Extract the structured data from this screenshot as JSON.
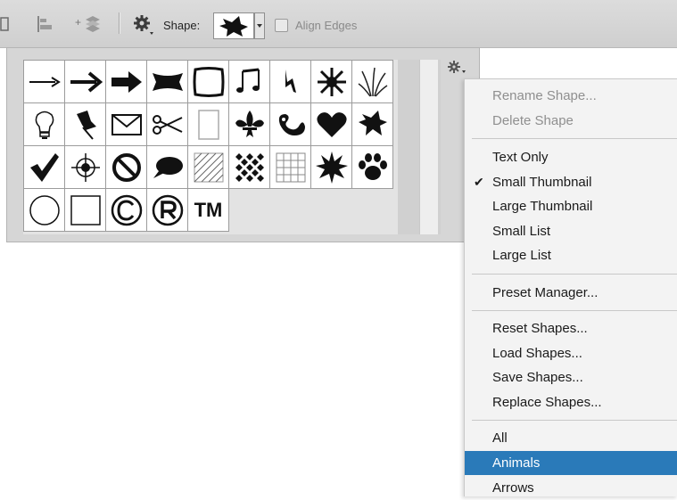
{
  "toolbar": {
    "shape_label": "Shape:",
    "align_edges_label": "Align Edges",
    "icons": [
      "path-operations-icon",
      "path-alignment-icon",
      "path-arrangement-icon",
      "gear-icon",
      "shape-picker-icon",
      "checkbox-icon"
    ]
  },
  "picker": {
    "shapes": [
      "thin-arrow",
      "bold-arrow",
      "heavy-arrow",
      "banner",
      "frame-square",
      "music-note",
      "lightning-bolt",
      "starburst",
      "grass",
      "light-bulb",
      "pushpin",
      "envelope",
      "scissors",
      "blank-page",
      "fleur-de-lis",
      "ornament",
      "heart",
      "puzzle-splat",
      "checkmark",
      "target-crosshair",
      "no-sign",
      "speech-bubble",
      "diagonal-lines",
      "checker-diamond",
      "grid",
      "burst",
      "paw-print",
      "circle-frame",
      "square-frame",
      "copyright",
      "registered",
      "trademark"
    ],
    "tm_text": "TM"
  },
  "menu": {
    "items": [
      {
        "label": "Rename Shape...",
        "state": "disabled"
      },
      {
        "label": "Delete Shape",
        "state": "disabled"
      },
      {
        "label": "Text Only",
        "state": "normal"
      },
      {
        "label": "Small Thumbnail",
        "state": "checked"
      },
      {
        "label": "Large Thumbnail",
        "state": "normal"
      },
      {
        "label": "Small List",
        "state": "normal"
      },
      {
        "label": "Large List",
        "state": "normal"
      },
      {
        "label": "Preset Manager...",
        "state": "normal"
      },
      {
        "label": "Reset Shapes...",
        "state": "normal"
      },
      {
        "label": "Load Shapes...",
        "state": "normal"
      },
      {
        "label": "Save Shapes...",
        "state": "normal"
      },
      {
        "label": "Replace Shapes...",
        "state": "normal"
      },
      {
        "label": "All",
        "state": "normal"
      },
      {
        "label": "Animals",
        "state": "highlighted"
      },
      {
        "label": "Arrows",
        "state": "normal"
      }
    ],
    "highlight_color": "#2a7ab9"
  }
}
